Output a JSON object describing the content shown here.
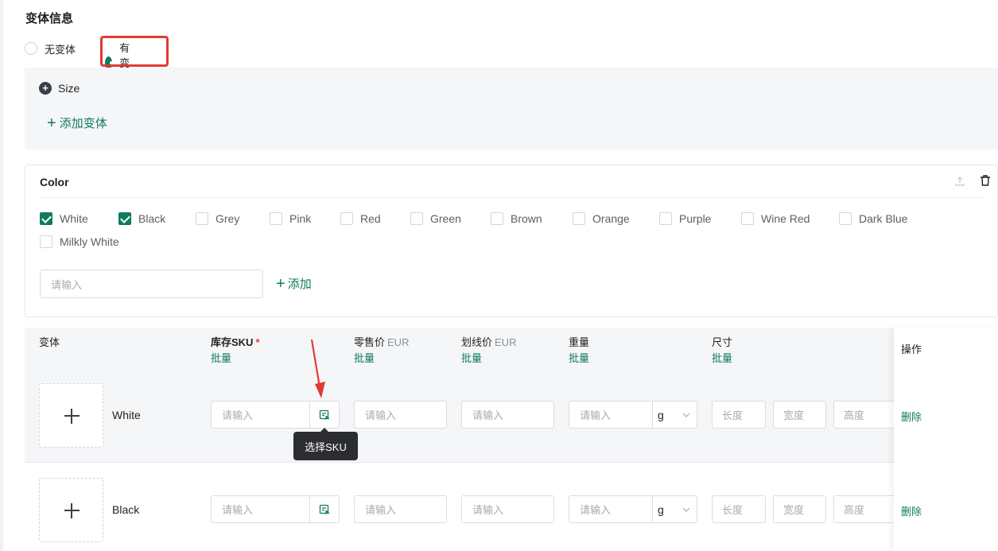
{
  "section": {
    "title": "变体信息"
  },
  "variant_mode": {
    "options": [
      {
        "label": "无变体",
        "checked": false
      },
      {
        "label": "有变体",
        "checked": true
      }
    ]
  },
  "size_group": {
    "name": "Size",
    "add_label": "添加变体"
  },
  "color_group": {
    "name": "Color",
    "options": [
      {
        "label": "White",
        "checked": true
      },
      {
        "label": "Black",
        "checked": true
      },
      {
        "label": "Grey",
        "checked": false
      },
      {
        "label": "Pink",
        "checked": false
      },
      {
        "label": "Red",
        "checked": false
      },
      {
        "label": "Green",
        "checked": false
      },
      {
        "label": "Brown",
        "checked": false
      },
      {
        "label": "Orange",
        "checked": false
      },
      {
        "label": "Purple",
        "checked": false
      },
      {
        "label": "Wine Red",
        "checked": false
      },
      {
        "label": "Dark Blue",
        "checked": false
      },
      {
        "label": "Milkly White",
        "checked": false
      }
    ],
    "input_placeholder": "请输入",
    "add_label": "添加"
  },
  "table": {
    "headers": {
      "variant": "变体",
      "sku": "库存SKU",
      "sku_required": "*",
      "retail": "零售价",
      "retail_currency": "EUR",
      "strike": "划线价",
      "strike_currency": "EUR",
      "weight": "重量",
      "size": "尺寸",
      "actions": "操作"
    },
    "batch_label": "批量",
    "rows": [
      {
        "name": "White",
        "sku_placeholder": "请输入",
        "retail_placeholder": "请输入",
        "strike_placeholder": "请输入",
        "weight_placeholder": "请输入",
        "weight_unit": "g",
        "length_placeholder": "长度",
        "width_placeholder": "宽度",
        "height_placeholder": "高度",
        "delete_label": "删除"
      },
      {
        "name": "Black",
        "sku_placeholder": "请输入",
        "retail_placeholder": "请输入",
        "strike_placeholder": "请输入",
        "weight_placeholder": "请输入",
        "weight_unit": "g",
        "length_placeholder": "长度",
        "width_placeholder": "宽度",
        "height_placeholder": "高度",
        "delete_label": "删除"
      }
    ]
  },
  "tooltip": {
    "text": "选择SKU"
  },
  "colors": {
    "accent": "#0f7b5c",
    "highlight": "#e33a2f",
    "panel_bg": "#f5f6f8"
  }
}
